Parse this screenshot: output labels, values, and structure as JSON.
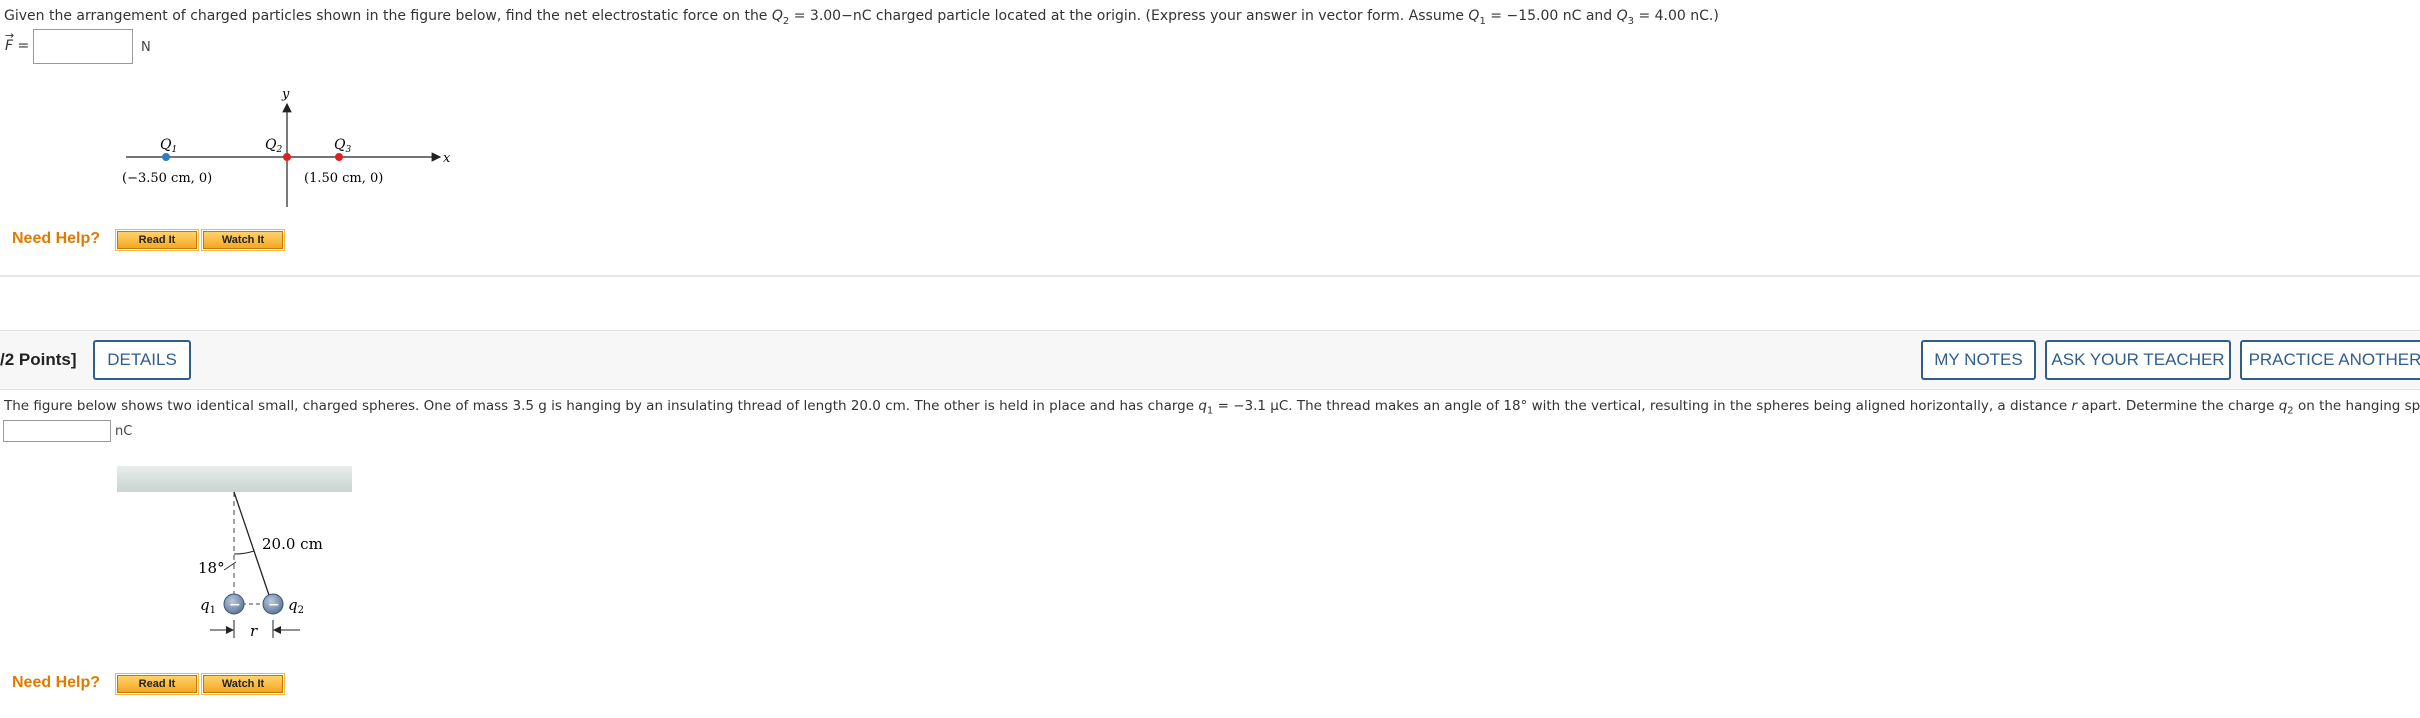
{
  "q1": {
    "text_a": "Given the arrangement of charged particles shown in the figure below, find the net electrostatic force on the ",
    "q2_sym": "Q",
    "q2_sub": "2",
    "text_b": " = 3.00−nC charged particle located at the origin. (Express your answer in vector form. Assume ",
    "q1_sym": "Q",
    "q1_sub": "1",
    "text_c": " = −15.00 nC and ",
    "q3_sym": "Q",
    "q3_sub": "3",
    "text_d": " = 4.00 nC.)",
    "answer_label": "F =",
    "answer_value": "",
    "unit": "N",
    "figure": {
      "axis_y": "y",
      "axis_x": "x",
      "label_q1": "Q",
      "label_q1_sub": "1",
      "label_q2": "Q",
      "label_q2_sub": "2",
      "label_q3": "Q",
      "label_q3_sub": "3",
      "coord_q1": "(−3.50 cm, 0)",
      "coord_q3": "(1.50 cm, 0)",
      "color_q1": "#2a7fc0",
      "color_q2": "#e02020",
      "color_q3": "#e02020"
    },
    "need_help": "Need Help?",
    "read_it": "Read It",
    "watch_it": "Watch It"
  },
  "q2": {
    "points": "/2 Points]",
    "details": "DETAILS",
    "my_notes": "MY NOTES",
    "ask_teacher": "ASK YOUR TEACHER",
    "practice": "PRACTICE ANOTHER",
    "text_a": "The figure below shows two identical small, charged spheres. One of mass 3.5 g is hanging by an insulating thread of length 20.0 cm. The other is held in place and has charge ",
    "q1_sym": "q",
    "q1_sub": "1",
    "text_b": " = −3.1 μC. The thread makes an angle of 18° with the vertical, resulting in the spheres being aligned horizontally, a distance ",
    "r_sym": "r",
    "text_c": " apart. Determine the charge ",
    "q2_sym": "q",
    "q2_sub": "2",
    "text_d": " on the hanging sphere.",
    "answer_value": "",
    "unit": "nC",
    "figure": {
      "length_label": "20.0 cm",
      "angle_label": "18°",
      "q1_label": "q",
      "q1_sub": "1",
      "q2_label": "q",
      "q2_sub": "2",
      "r_label": "r",
      "sphere_sign": "−"
    },
    "need_help": "Need Help?",
    "read_it": "Read It",
    "watch_it": "Watch It"
  }
}
